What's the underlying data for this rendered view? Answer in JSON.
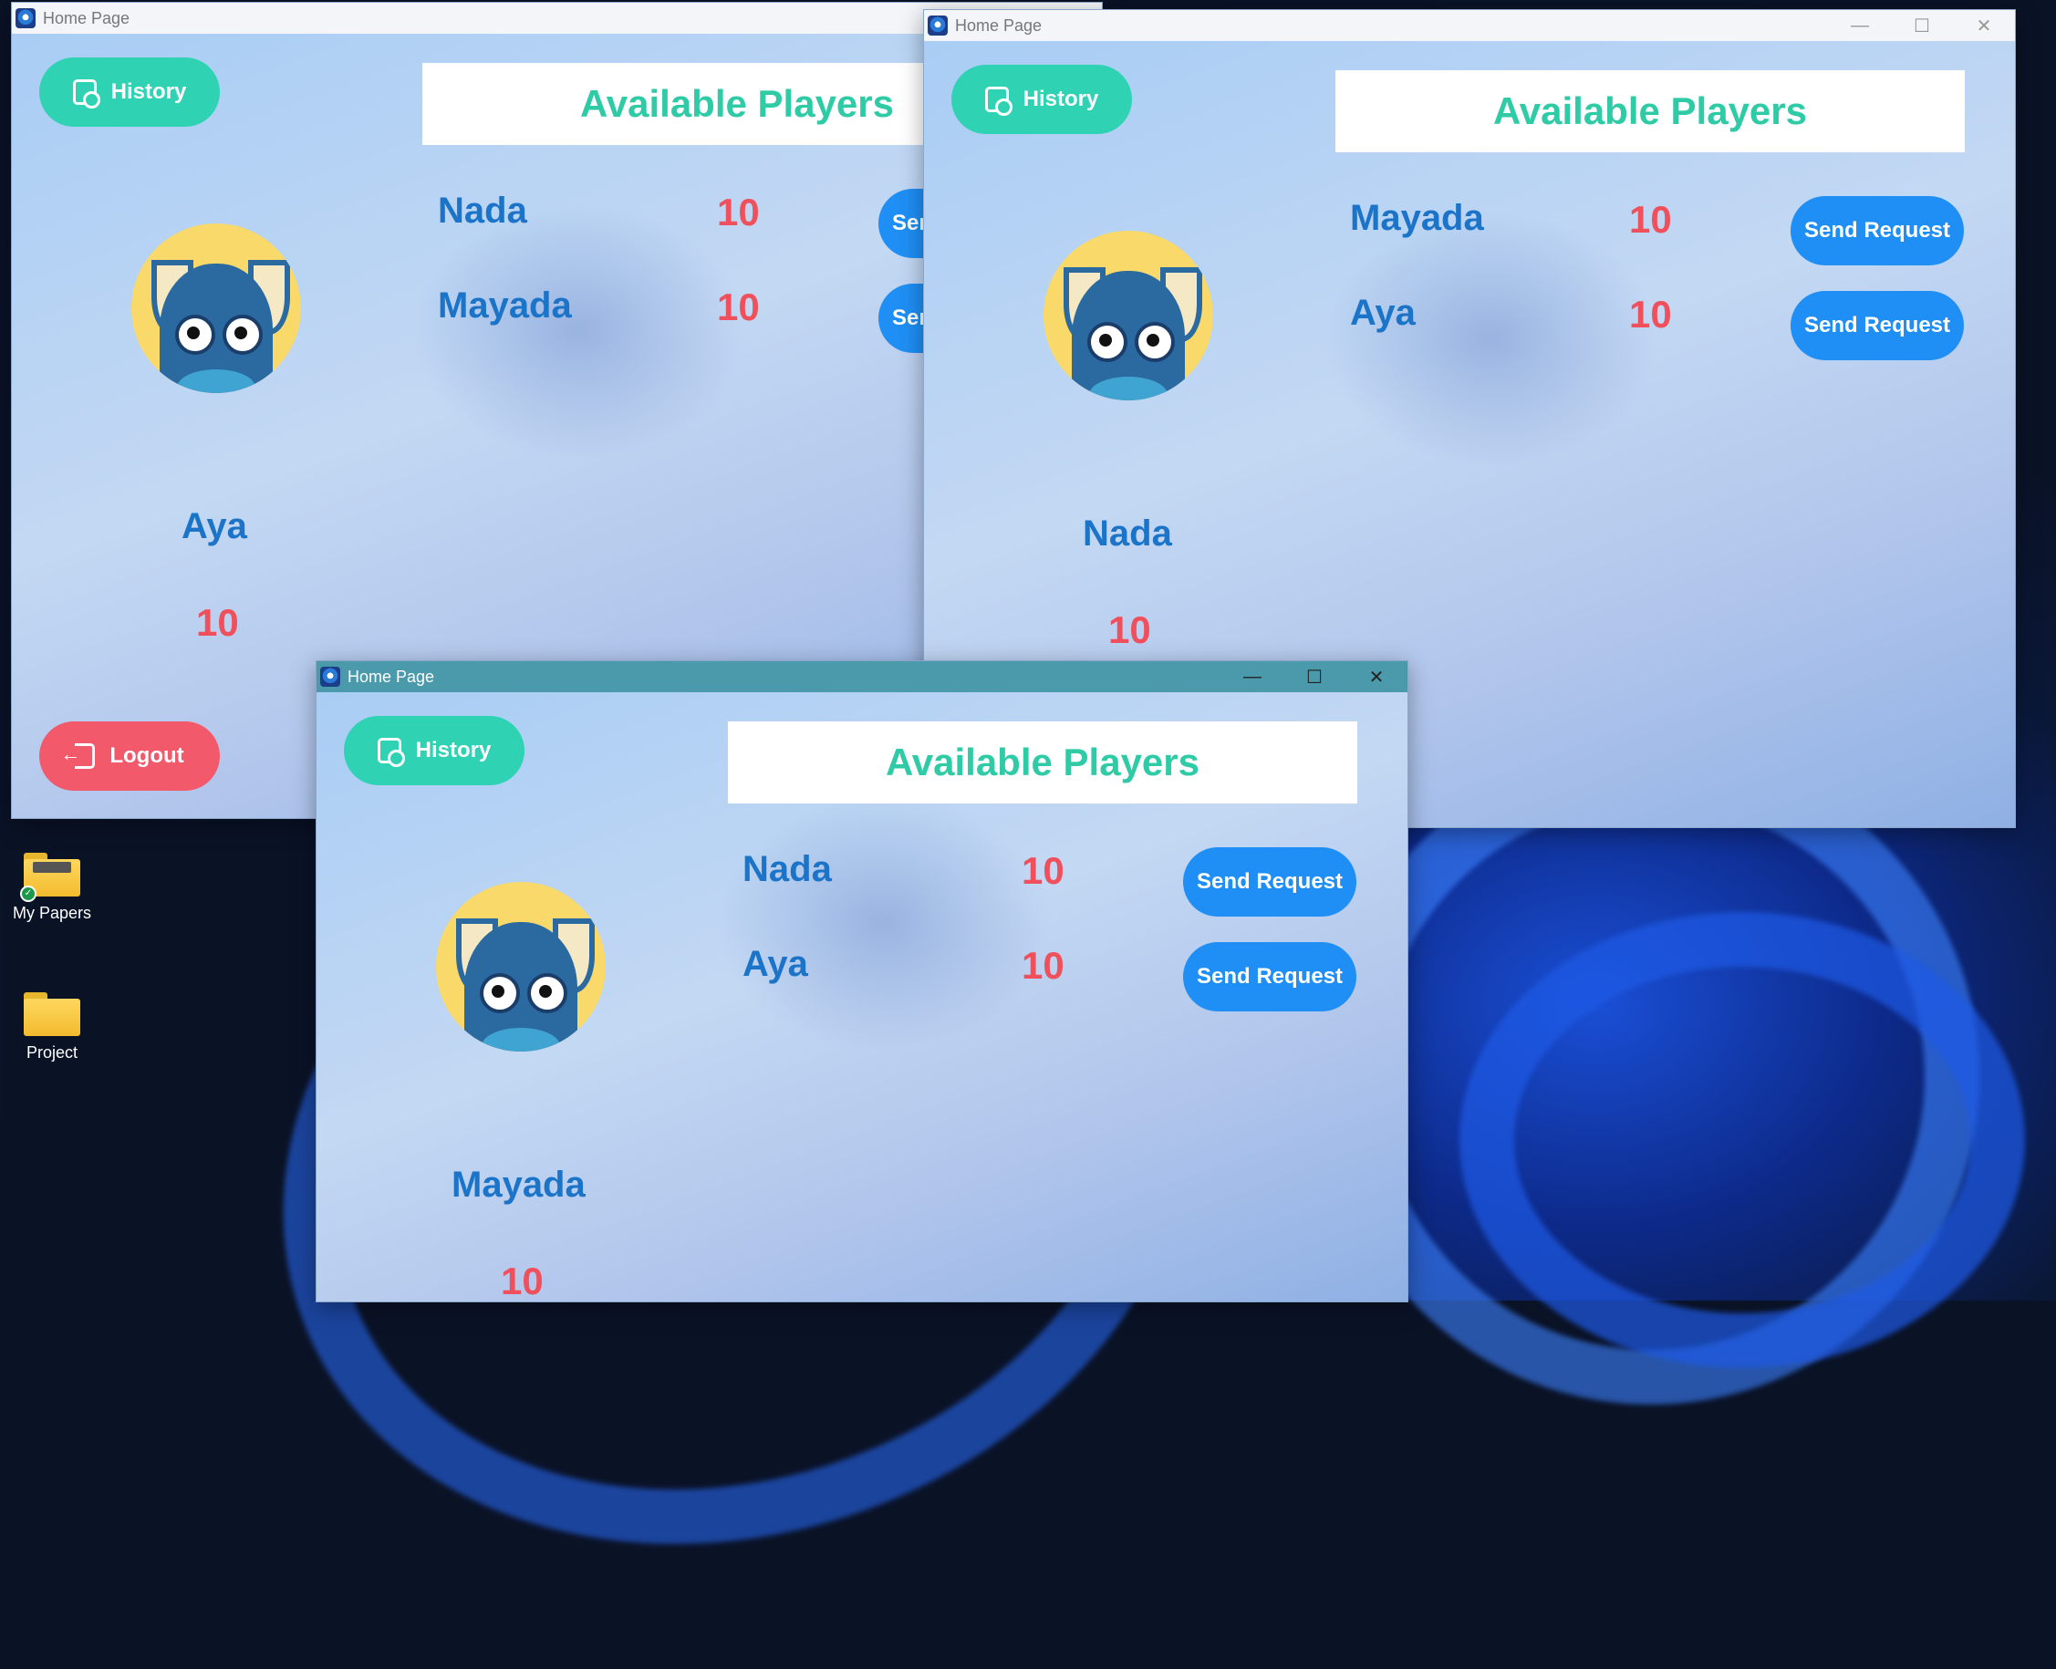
{
  "desktop": {
    "icons": [
      {
        "label": "My Papers"
      },
      {
        "label": "Project"
      }
    ]
  },
  "windows": [
    {
      "title": "Home Page",
      "history_label": "History",
      "logout_label": "Logout",
      "panel_title": "Available Players",
      "user": {
        "name": "Aya",
        "score": "10"
      },
      "players": [
        {
          "name": "Nada",
          "score": "10",
          "action": "Send Request"
        },
        {
          "name": "Mayada",
          "score": "10",
          "action": "Send Request"
        }
      ]
    },
    {
      "title": "Home Page",
      "history_label": "History",
      "panel_title": "Available Players",
      "user": {
        "name": "Nada",
        "score": "10"
      },
      "players": [
        {
          "name": "Mayada",
          "score": "10",
          "action": "Send Request"
        },
        {
          "name": "Aya",
          "score": "10",
          "action": "Send Request"
        }
      ]
    },
    {
      "title": "Home Page",
      "history_label": "History",
      "panel_title": "Available Players",
      "user": {
        "name": "Mayada",
        "score": "10"
      },
      "players": [
        {
          "name": "Nada",
          "score": "10",
          "action": "Send Request"
        },
        {
          "name": "Aya",
          "score": "10",
          "action": "Send Request"
        }
      ]
    }
  ]
}
